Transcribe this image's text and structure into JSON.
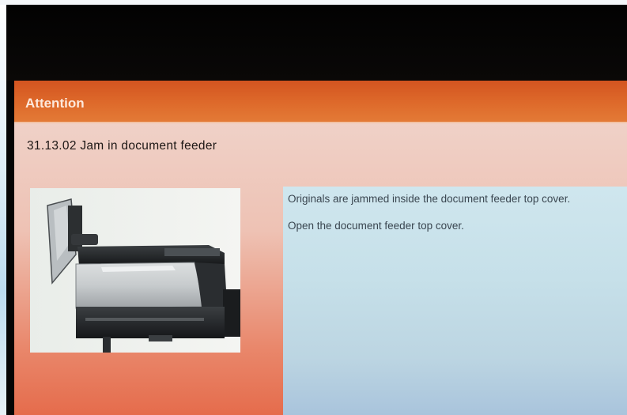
{
  "dialog": {
    "title": "Attention",
    "message_title": "31.13.02 Jam in document feeder",
    "instruction_1": "Originals are jammed inside the document feeder top cover.",
    "instruction_2": "Open the document feeder top cover."
  },
  "illustration": {
    "subject": "document-feeder-illustration"
  },
  "colors": {
    "titlebar": "#d9612a",
    "panel": "#c8e1ea",
    "dialog_background": "#efc9bd"
  }
}
